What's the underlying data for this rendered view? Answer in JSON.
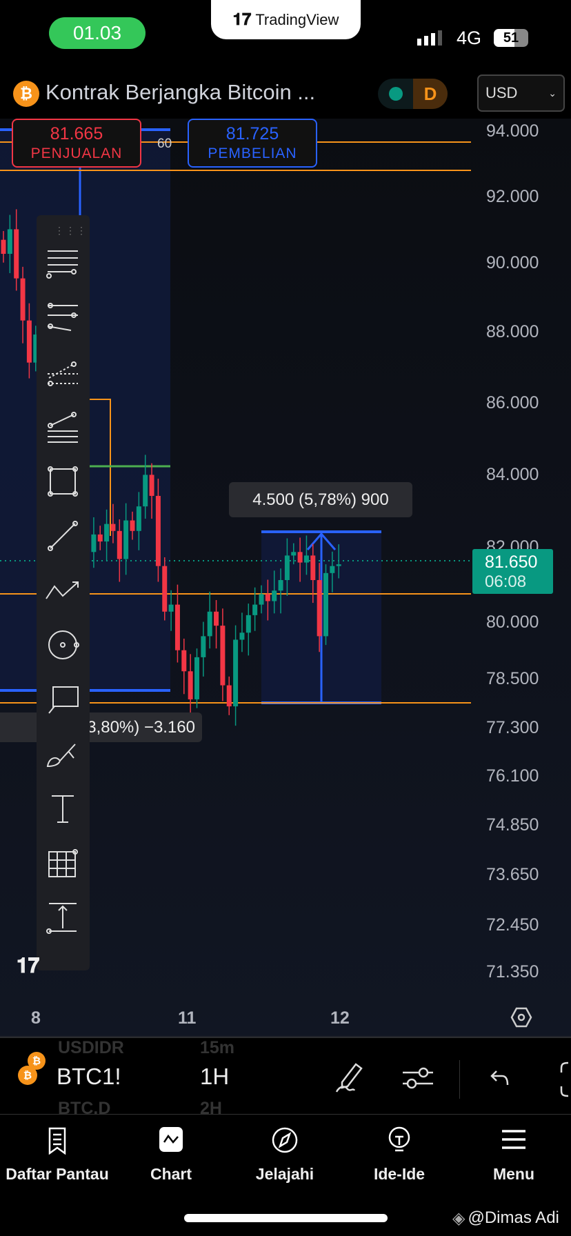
{
  "status": {
    "time": "01.03",
    "network": "4G",
    "battery": "51",
    "notch_brand": "TradingView"
  },
  "header": {
    "title": "Kontrak Berjangka Bitcoin ...",
    "badge": "D",
    "currency": "USD"
  },
  "sell": {
    "price": "81.665",
    "label": "PENJUALAN"
  },
  "buy": {
    "price": "81.725",
    "label": "PEMBELIAN"
  },
  "small_label": "60",
  "price_axis": [
    "94.000",
    "92.000",
    "90.000",
    "88.000",
    "86.000",
    "84.000",
    "82.000",
    "80.000",
    "78.500",
    "77.300",
    "76.100",
    "74.850",
    "73.650",
    "72.450",
    "71.350"
  ],
  "current_price": {
    "price": "81.650",
    "countdown": "06:08"
  },
  "long_tooltip": "4.500 (5,78%) 900",
  "short_tooltip": ".800 (−3,80%) −3.160",
  "time_axis": [
    "8",
    "11",
    "12"
  ],
  "colors": {
    "up": "#089981",
    "down": "#f23645",
    "accent": "#2962ff",
    "orange": "#f7931a"
  },
  "candles_close": [
    90.5,
    91.2,
    89.8,
    88.6,
    87.4,
    88.2,
    87.0,
    86.0,
    85.2,
    84.5,
    83.8,
    83.0,
    82.6,
    82.0,
    82.5,
    82.3,
    82.8,
    82.6,
    81.8,
    82.9,
    82.6,
    83.3,
    84.2,
    83.6,
    81.6,
    80.3,
    80.5,
    79.2,
    78.6,
    77.8,
    79.0,
    79.6,
    80.3,
    79.9,
    78.2,
    77.6,
    79.5,
    79.7,
    80.2,
    80.5,
    80.8,
    80.6,
    80.9,
    81.2,
    81.9,
    82.0,
    81.7,
    81.9,
    81.2,
    79.6,
    81.4,
    81.6,
    81.65
  ],
  "toolbar": [
    "horizontal-lines",
    "pitchfork",
    "fib-retracement",
    "trend-based-fib",
    "rectangle",
    "trend-line",
    "path",
    "circle",
    "callout",
    "brush",
    "text",
    "grid",
    "measure"
  ],
  "bottom_bar": {
    "symbol": "BTC1!",
    "interval": "1H",
    "prev_symbol": "USDIDR",
    "prev_interval": "15m",
    "next_symbol": "BTC.D",
    "next_interval": "2H"
  },
  "nav": [
    {
      "label": "Daftar Pantau"
    },
    {
      "label": "Chart"
    },
    {
      "label": "Jelajahi"
    },
    {
      "label": "Ide-Ide"
    },
    {
      "label": "Menu"
    }
  ],
  "watermark": "@Dimas Adi"
}
